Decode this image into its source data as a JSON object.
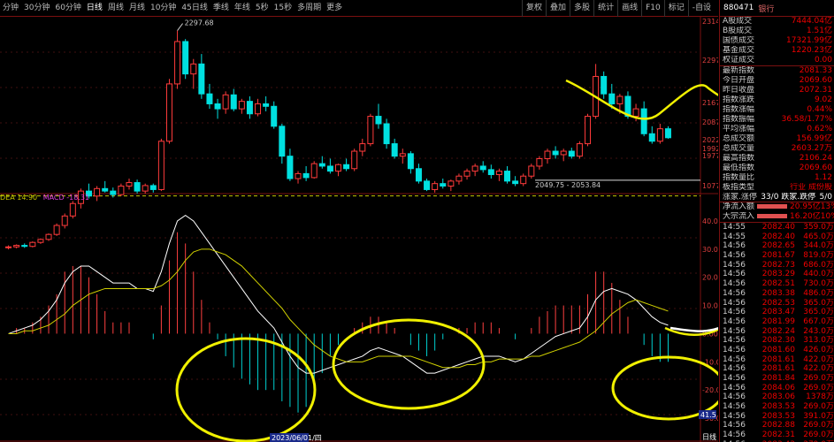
{
  "toolbar": {
    "periods": [
      "分钟",
      "30分钟",
      "60分钟",
      "日线",
      "周线",
      "月线",
      "10分钟",
      "45日线",
      "季线",
      "年线",
      "5秒",
      "15秒",
      "多周期",
      "更多"
    ],
    "active_index": 3,
    "right_buttons": [
      "复权",
      "叠加",
      "多股",
      "统计",
      "画线",
      "F10",
      "标记",
      "-自设"
    ]
  },
  "annotations": {
    "high_label": "2297.68",
    "range_label": "2049.75 - 2053.84",
    "date_label": "2023/06/01/四",
    "cursor_value": "41.5",
    "bottom_right_label": "日线"
  },
  "price_axis": [
    "2314",
    "2297",
    "2167",
    "2087",
    "2022",
    "1992",
    "1977",
    "1077"
  ],
  "indicator": {
    "dea": "DEA 14.90",
    "macd": "MACD -18.31"
  },
  "indicator_axis": [
    "40.00",
    "30.00",
    "20.00",
    "10.00",
    "0.00",
    "-10.00",
    "-20.00",
    "-30.00"
  ],
  "panel": {
    "code": "880471",
    "name": "银行",
    "rows_top": [
      {
        "k": "A股成交",
        "v": "7444.04亿"
      },
      {
        "k": "B股成交",
        "v": "1.51亿"
      },
      {
        "k": "国债成交",
        "v": "17321.99亿"
      },
      {
        "k": "基金成交",
        "v": "1220.23亿"
      },
      {
        "k": "权证成交",
        "v": "0.00"
      }
    ],
    "rows_mid": [
      {
        "k": "最新指数",
        "v": "2081.33"
      },
      {
        "k": "今日开盘",
        "v": "2069.60"
      },
      {
        "k": "昨日收盘",
        "v": "2072.31"
      },
      {
        "k": "指数涨跌",
        "v": "9.02"
      },
      {
        "k": "指数涨幅",
        "v": "0.44%"
      },
      {
        "k": "指数振幅",
        "v": "36.58/1.77%"
      },
      {
        "k": "平均涨幅",
        "v": "0.62%"
      },
      {
        "k": "总成交额",
        "v": "156.99亿"
      },
      {
        "k": "总成交量",
        "v": "2603.27万"
      },
      {
        "k": "最高指数",
        "v": "2106.24"
      },
      {
        "k": "最低指数",
        "v": "2069.60"
      },
      {
        "k": "指数量比",
        "v": "1.12"
      },
      {
        "k": "板指类型",
        "v": "行业 成份股"
      }
    ],
    "updown": {
      "k": "涨家.涨停",
      "v": "33/0 跌家.跌停",
      "v2": "5/0"
    },
    "flows": [
      {
        "k": "净流入额",
        "v": "20.95亿",
        "pct": "13%"
      },
      {
        "k": "大宗流入",
        "v": "16.20亿",
        "pct": "10%"
      }
    ],
    "ticks": [
      {
        "t": "14:55",
        "p": "2082.40",
        "q": "359.0万"
      },
      {
        "t": "14:55",
        "p": "2082.40",
        "q": "465.0万"
      },
      {
        "t": "14:56",
        "p": "2082.65",
        "q": "344.0万"
      },
      {
        "t": "14:56",
        "p": "2081.67",
        "q": "819.0万"
      },
      {
        "t": "14:56",
        "p": "2082.73",
        "q": "686.0万"
      },
      {
        "t": "14:56",
        "p": "2083.29",
        "q": "440.0万"
      },
      {
        "t": "14:56",
        "p": "2082.51",
        "q": "730.0万"
      },
      {
        "t": "14:56",
        "p": "2083.38",
        "q": "486.0万"
      },
      {
        "t": "14:56",
        "p": "2082.53",
        "q": "365.0万"
      },
      {
        "t": "14:56",
        "p": "2083.47",
        "q": "365.0万"
      },
      {
        "t": "14:56",
        "p": "2081.99",
        "q": "667.0万"
      },
      {
        "t": "14:56",
        "p": "2082.24",
        "q": "243.0万"
      },
      {
        "t": "14:56",
        "p": "2082.30",
        "q": "313.0万"
      },
      {
        "t": "14:56",
        "p": "2081.60",
        "q": "426.0万"
      },
      {
        "t": "14:56",
        "p": "2081.61",
        "q": "422.0万"
      },
      {
        "t": "14:56",
        "p": "2081.61",
        "q": "422.0万"
      },
      {
        "t": "14:56",
        "p": "2081.84",
        "q": "269.0万"
      },
      {
        "t": "14:56",
        "p": "2084.06",
        "q": "269.0万"
      },
      {
        "t": "14:56",
        "p": "2083.06",
        "q": "1378万"
      },
      {
        "t": "14:56",
        "p": "2083.53",
        "q": "269.0万"
      },
      {
        "t": "14:56",
        "p": "2083.53",
        "q": "391.0万"
      },
      {
        "t": "14:56",
        "p": "2082.88",
        "q": "269.0万"
      },
      {
        "t": "14:56",
        "p": "2082.31",
        "q": "269.0万"
      },
      {
        "t": "14:56",
        "p": "2083.43",
        "q": "279.0万"
      },
      {
        "t": "15:00",
        "p": "2083.25",
        "q": "269.0万"
      }
    ]
  },
  "chart_data": {
    "type": "candlestick+macd",
    "candles": [
      [
        1862,
        1866,
        1858,
        1863
      ],
      [
        1863,
        1868,
        1860,
        1866
      ],
      [
        1866,
        1870,
        1861,
        1864
      ],
      [
        1864,
        1874,
        1862,
        1872
      ],
      [
        1872,
        1880,
        1869,
        1878
      ],
      [
        1878,
        1890,
        1875,
        1888
      ],
      [
        1888,
        1910,
        1885,
        1906
      ],
      [
        1906,
        1930,
        1900,
        1925
      ],
      [
        1925,
        1955,
        1920,
        1950
      ],
      [
        1950,
        1980,
        1940,
        1975
      ],
      [
        1975,
        1990,
        1960,
        1965
      ],
      [
        1965,
        1985,
        1955,
        1980
      ],
      [
        1980,
        1995,
        1972,
        1975
      ],
      [
        1975,
        1982,
        1962,
        1968
      ],
      [
        1968,
        1990,
        1965,
        1985
      ],
      [
        1985,
        2000,
        1978,
        1992
      ],
      [
        1992,
        1998,
        1970,
        1975
      ],
      [
        1975,
        1990,
        1970,
        1986
      ],
      [
        1986,
        1990,
        1972,
        1978
      ],
      [
        1978,
        2080,
        1975,
        2075
      ],
      [
        2075,
        2200,
        2070,
        2190
      ],
      [
        2190,
        2297,
        2180,
        2275
      ],
      [
        2275,
        2280,
        2200,
        2210
      ],
      [
        2210,
        2240,
        2180,
        2230
      ],
      [
        2230,
        2250,
        2160,
        2170
      ],
      [
        2170,
        2190,
        2140,
        2150
      ],
      [
        2150,
        2160,
        2120,
        2140
      ],
      [
        2140,
        2175,
        2130,
        2168
      ],
      [
        2168,
        2180,
        2135,
        2140
      ],
      [
        2140,
        2160,
        2130,
        2155
      ],
      [
        2155,
        2165,
        2120,
        2130
      ],
      [
        2130,
        2160,
        2125,
        2150
      ],
      [
        2150,
        2165,
        2135,
        2145
      ],
      [
        2145,
        2155,
        2100,
        2105
      ],
      [
        2105,
        2110,
        2030,
        2045
      ],
      [
        2045,
        2060,
        1995,
        2000
      ],
      [
        2000,
        2015,
        1990,
        2010
      ],
      [
        2010,
        2025,
        1995,
        2002
      ],
      [
        2002,
        2035,
        2000,
        2030
      ],
      [
        2030,
        2045,
        2020,
        2025
      ],
      [
        2025,
        2040,
        2010,
        2015
      ],
      [
        2015,
        2030,
        2005,
        2028
      ],
      [
        2028,
        2040,
        2015,
        2020
      ],
      [
        2020,
        2060,
        2015,
        2055
      ],
      [
        2055,
        2080,
        2045,
        2070
      ],
      [
        2070,
        2130,
        2065,
        2125
      ],
      [
        2125,
        2150,
        2100,
        2110
      ],
      [
        2110,
        2120,
        2060,
        2070
      ],
      [
        2070,
        2080,
        2040,
        2045
      ],
      [
        2045,
        2060,
        2030,
        2050
      ],
      [
        2050,
        2055,
        2010,
        2020
      ],
      [
        2020,
        2030,
        1990,
        1995
      ],
      [
        1995,
        2000,
        1975,
        1978
      ],
      [
        1978,
        1995,
        1972,
        1990
      ],
      [
        1990,
        2000,
        1980,
        1985
      ],
      [
        1985,
        1998,
        1975,
        1995
      ],
      [
        1995,
        2010,
        1988,
        2005
      ],
      [
        2005,
        2020,
        1998,
        2015
      ],
      [
        2015,
        2030,
        2005,
        2025
      ],
      [
        2025,
        2035,
        2012,
        2018
      ],
      [
        2018,
        2028,
        2000,
        2008
      ],
      [
        2008,
        2020,
        1995,
        2015
      ],
      [
        2015,
        2025,
        1990,
        1995
      ],
      [
        1995,
        2005,
        1985,
        1990
      ],
      [
        1990,
        2010,
        1985,
        2005
      ],
      [
        2005,
        2030,
        2000,
        2025
      ],
      [
        2025,
        2045,
        2018,
        2040
      ],
      [
        2040,
        2060,
        2030,
        2055
      ],
      [
        2055,
        2065,
        2040,
        2048
      ],
      [
        2048,
        2060,
        2035,
        2055
      ],
      [
        2055,
        2062,
        2040,
        2045
      ],
      [
        2045,
        2075,
        2040,
        2070
      ],
      [
        2070,
        2130,
        2065,
        2125
      ],
      [
        2125,
        2230,
        2120,
        2205
      ],
      [
        2205,
        2215,
        2160,
        2170
      ],
      [
        2170,
        2190,
        2140,
        2150
      ],
      [
        2150,
        2170,
        2130,
        2165
      ],
      [
        2165,
        2175,
        2120,
        2125
      ],
      [
        2125,
        2150,
        2115,
        2140
      ],
      [
        2140,
        2155,
        2085,
        2090
      ],
      [
        2090,
        2105,
        2070,
        2075
      ],
      [
        2075,
        2110,
        2070,
        2100
      ],
      [
        2100,
        2105,
        2080,
        2082
      ]
    ],
    "dif": [
      0,
      1,
      2,
      3,
      5,
      8,
      12,
      18,
      22,
      24,
      24,
      22,
      20,
      18,
      18,
      18,
      16,
      16,
      15,
      22,
      32,
      40,
      42,
      40,
      36,
      32,
      28,
      24,
      20,
      16,
      12,
      8,
      5,
      2,
      -3,
      -8,
      -12,
      -14,
      -14,
      -13,
      -12,
      -11,
      -10,
      -9,
      -8,
      -6,
      -5,
      -6,
      -7,
      -8,
      -10,
      -12,
      -14,
      -14,
      -13,
      -12,
      -11,
      -10,
      -9,
      -8,
      -8,
      -8,
      -9,
      -10,
      -9,
      -7,
      -5,
      -3,
      -1,
      0,
      1,
      2,
      6,
      12,
      15,
      16,
      15,
      14,
      12,
      9,
      6,
      4,
      3
    ],
    "dea": [
      0,
      0,
      1,
      1,
      2,
      3,
      5,
      7,
      10,
      12,
      14,
      15,
      16,
      16,
      16,
      16,
      16,
      16,
      16,
      17,
      19,
      22,
      26,
      29,
      30,
      30,
      29,
      28,
      26,
      24,
      21,
      18,
      15,
      12,
      9,
      5,
      2,
      -1,
      -4,
      -6,
      -8,
      -9,
      -10,
      -10,
      -10,
      -9,
      -8,
      -8,
      -8,
      -8,
      -8,
      -9,
      -10,
      -11,
      -12,
      -12,
      -12,
      -11,
      -11,
      -10,
      -10,
      -9,
      -9,
      -9,
      -9,
      -8,
      -8,
      -7,
      -6,
      -5,
      -4,
      -3,
      -1,
      1,
      4,
      7,
      9,
      11,
      12,
      11,
      10,
      9,
      8
    ],
    "ylim": [
      1977,
      2314
    ],
    "macd_ylim": [
      -35,
      45
    ]
  }
}
